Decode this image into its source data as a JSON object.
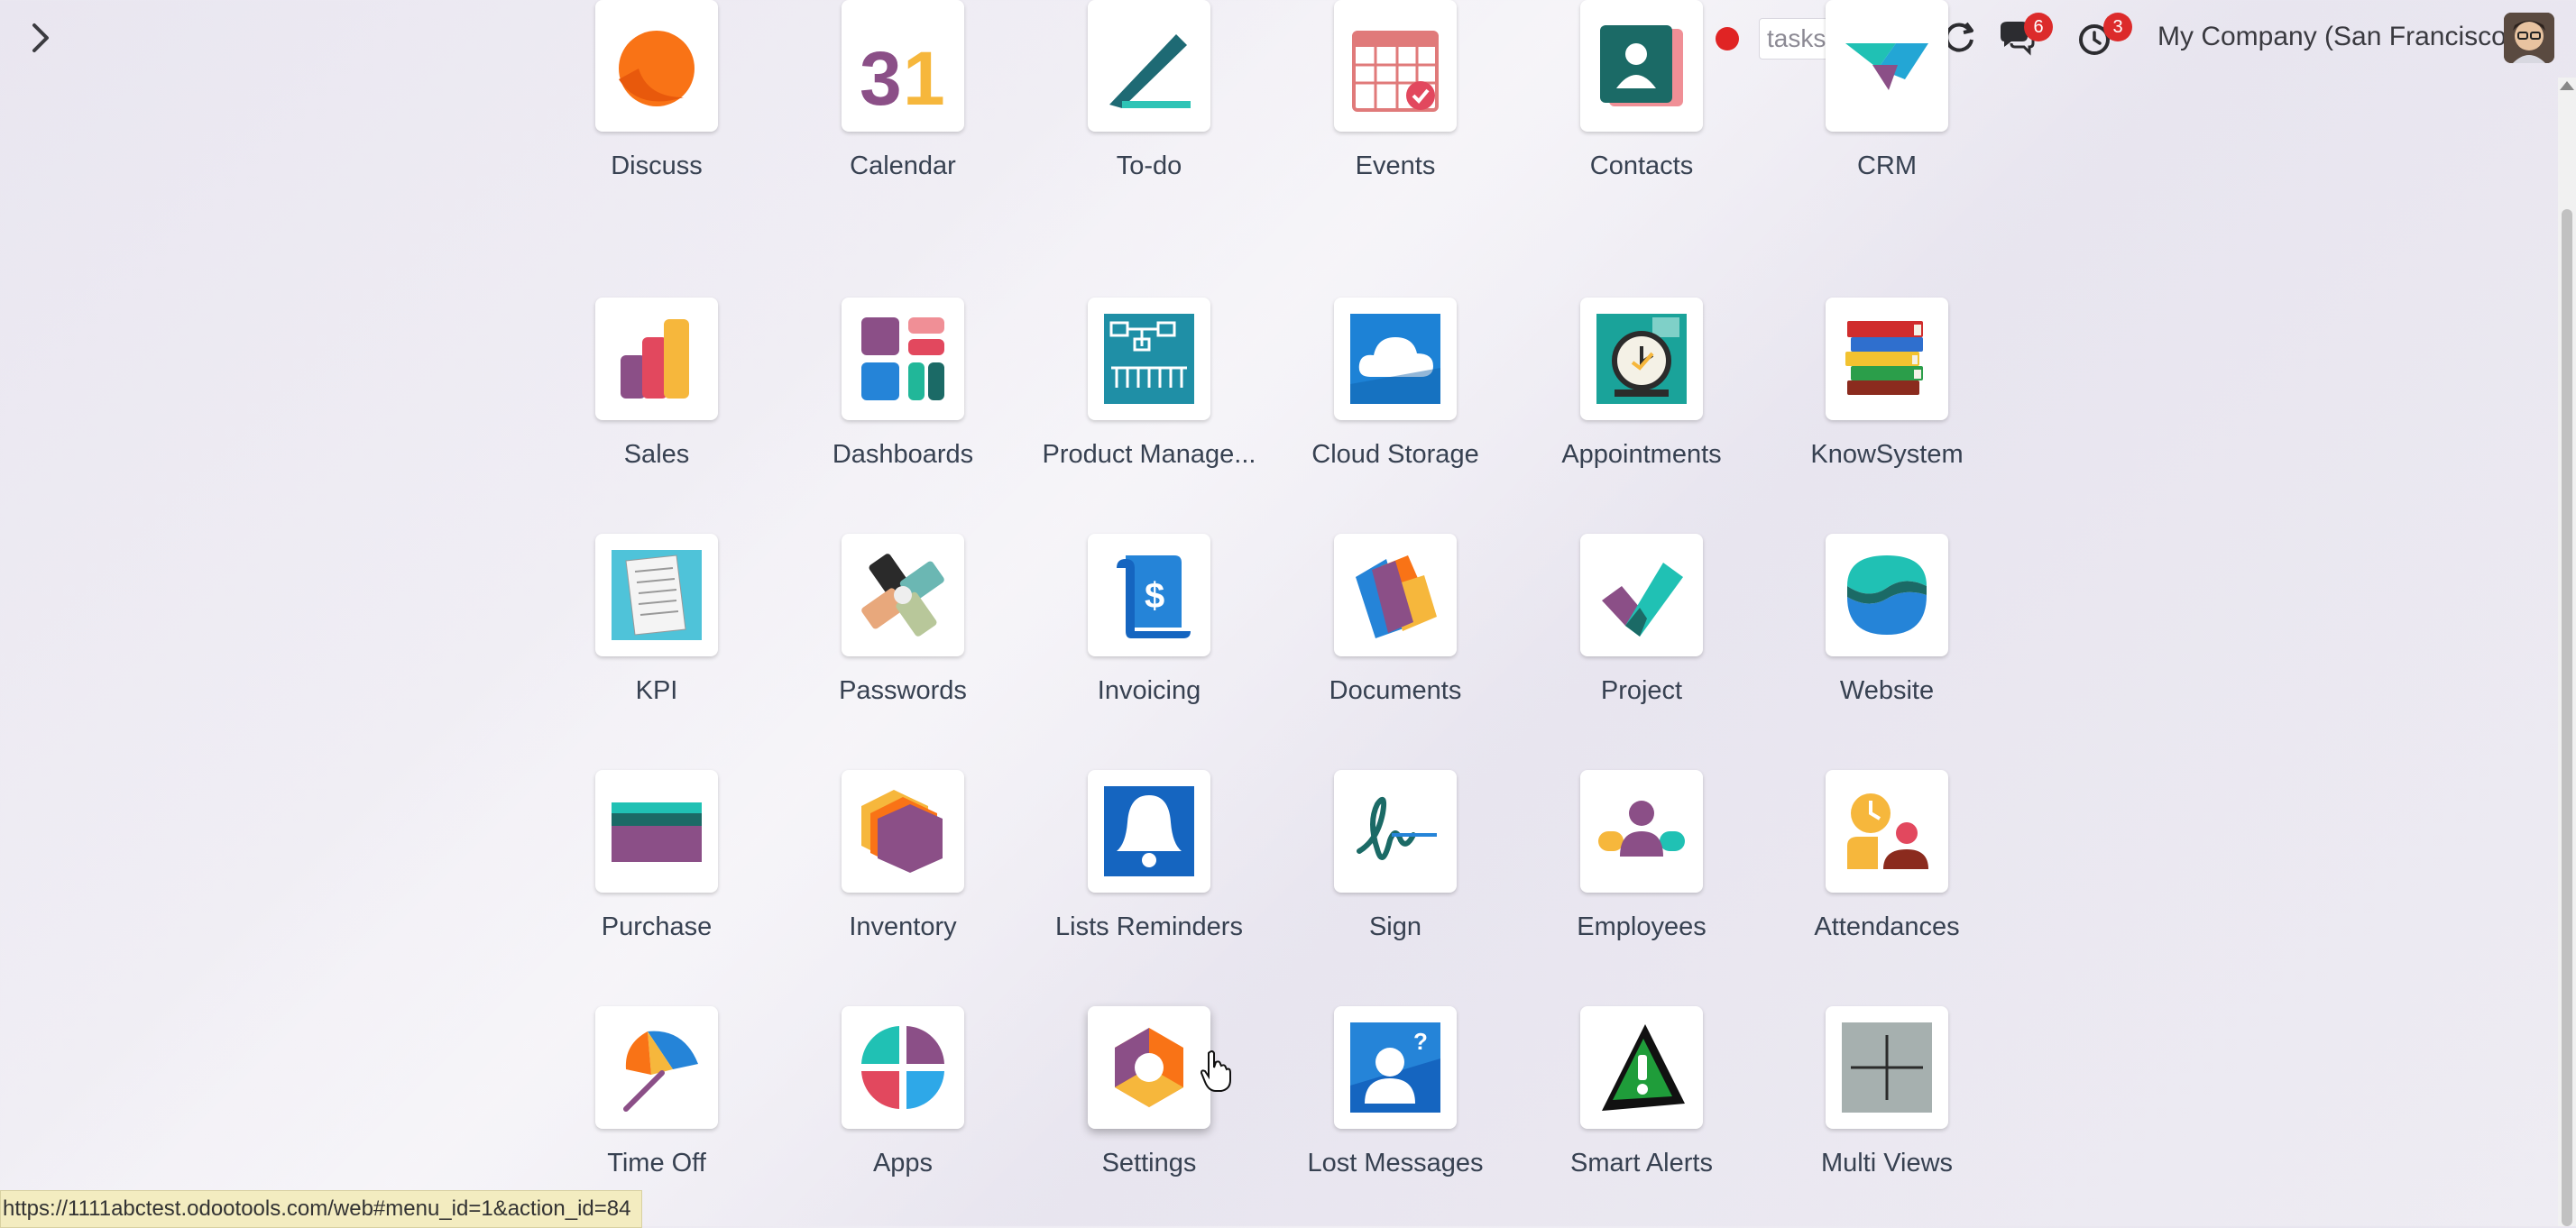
{
  "topbar": {
    "search_placeholder": "tasks search",
    "messages_count": "6",
    "activities_count": "3",
    "company": "My Company (San Francisco)"
  },
  "apps": [
    {
      "label": "Discuss",
      "icon": "discuss-icon"
    },
    {
      "label": "Calendar",
      "icon": "calendar-icon"
    },
    {
      "label": "To-do",
      "icon": "todo-icon"
    },
    {
      "label": "Events",
      "icon": "events-icon"
    },
    {
      "label": "Contacts",
      "icon": "contacts-icon"
    },
    {
      "label": "CRM",
      "icon": "crm-icon"
    },
    {
      "label": "Sales",
      "icon": "sales-icon"
    },
    {
      "label": "Dashboards",
      "icon": "dashboards-icon"
    },
    {
      "label": "Product Manage...",
      "icon": "product-management-icon"
    },
    {
      "label": "Cloud Storage",
      "icon": "cloud-storage-icon"
    },
    {
      "label": "Appointments",
      "icon": "appointments-icon"
    },
    {
      "label": "KnowSystem",
      "icon": "knowsystem-icon"
    },
    {
      "label": "KPI",
      "icon": "kpi-icon"
    },
    {
      "label": "Passwords",
      "icon": "passwords-icon"
    },
    {
      "label": "Invoicing",
      "icon": "invoicing-icon"
    },
    {
      "label": "Documents",
      "icon": "documents-icon"
    },
    {
      "label": "Project",
      "icon": "project-icon"
    },
    {
      "label": "Website",
      "icon": "website-icon"
    },
    {
      "label": "Purchase",
      "icon": "purchase-icon"
    },
    {
      "label": "Inventory",
      "icon": "inventory-icon"
    },
    {
      "label": "Lists Reminders",
      "icon": "lists-reminders-icon"
    },
    {
      "label": "Sign",
      "icon": "sign-icon"
    },
    {
      "label": "Employees",
      "icon": "employees-icon"
    },
    {
      "label": "Attendances",
      "icon": "attendances-icon"
    },
    {
      "label": "Time Off",
      "icon": "time-off-icon"
    },
    {
      "label": "Apps",
      "icon": "apps-icon"
    },
    {
      "label": "Settings",
      "icon": "settings-icon"
    },
    {
      "label": "Lost Messages",
      "icon": "lost-messages-icon"
    },
    {
      "label": "Smart Alerts",
      "icon": "smart-alerts-icon"
    },
    {
      "label": "Multi Views",
      "icon": "multi-views-icon"
    }
  ],
  "status_url": "https://1111abctest.odootools.com/web#menu_id=1&action_id=84"
}
